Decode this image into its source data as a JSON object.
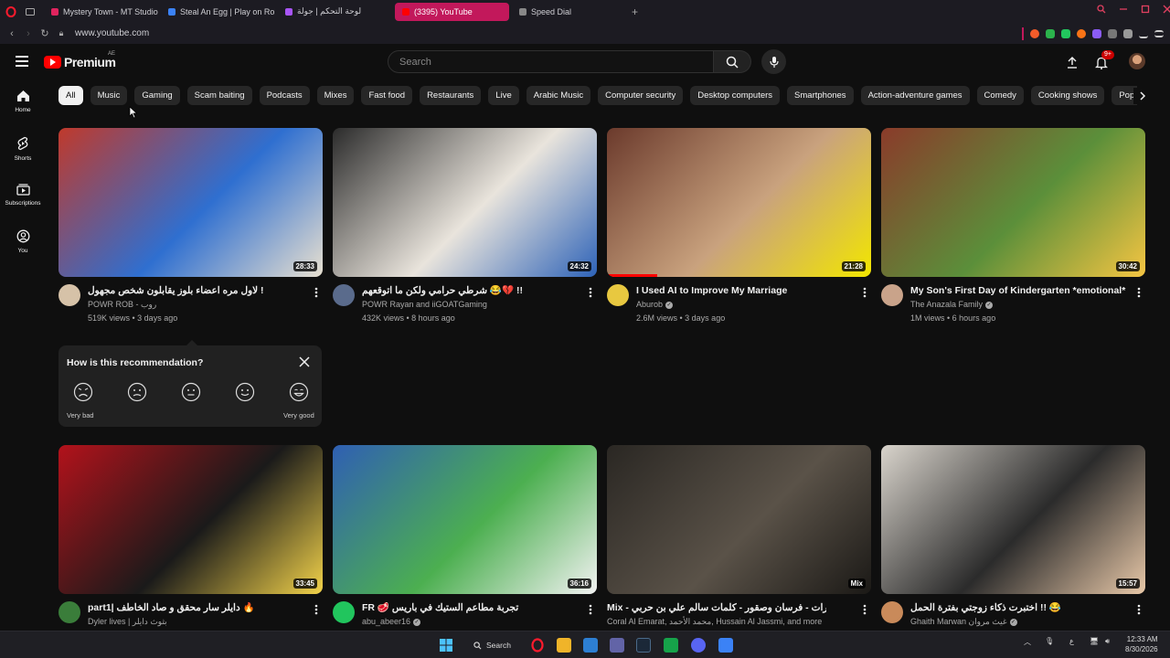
{
  "browser": {
    "tabs": [
      {
        "label": "Mystery Town - MT Studio",
        "color": "#e0245e",
        "active": false
      },
      {
        "label": "Steal An Egg | Play on Rob",
        "color": "#3b82f6",
        "active": false
      },
      {
        "label": "لوحة التحكم | جولة",
        "color": "#a855f7",
        "active": false
      },
      {
        "label": "(3395) YouTube",
        "color": "#ff0000",
        "active": true
      },
      {
        "label": "Speed Dial",
        "color": "#888888",
        "active": false
      }
    ],
    "url": "www.youtube.com",
    "accent": "#c2185b"
  },
  "header": {
    "logo_text": "Premium",
    "country_code": "AE",
    "search_placeholder": "Search",
    "notification_count": "9+"
  },
  "sidebar": {
    "items": [
      {
        "label": "Home",
        "icon": "home-icon"
      },
      {
        "label": "Shorts",
        "icon": "shorts-icon"
      },
      {
        "label": "Subscriptions",
        "icon": "subscriptions-icon"
      },
      {
        "label": "You",
        "icon": "you-icon"
      }
    ]
  },
  "chips": [
    "All",
    "Music",
    "Gaming",
    "Scam baiting",
    "Podcasts",
    "Mixes",
    "Fast food",
    "Restaurants",
    "Live",
    "Arabic Music",
    "Computer security",
    "Desktop computers",
    "Smartphones",
    "Action-adventure games",
    "Comedy",
    "Cooking shows",
    "Pop Music"
  ],
  "videos": [
    {
      "title": "لاول مره اعضاء بلوز يقابلون شخص مجهول !",
      "channel": "POWR ROB - روب",
      "stats": "519K views • 3 days ago",
      "duration": "28:33",
      "verified": false,
      "colors": [
        "#c0392b",
        "#2f6fd0",
        "#e8e0d0"
      ],
      "avatar_color": "#d6c2a8"
    },
    {
      "title": "شرطي حرامي ولكن ما اتوقعهم 😂💔 !!",
      "channel": "POWR Rayan and iiGOATGaming",
      "stats": "432K views • 8 hours ago",
      "duration": "24:32",
      "verified": false,
      "colors": [
        "#2b2b2b",
        "#e9e4dc",
        "#2e63b8"
      ],
      "avatar_color": "#5a6b8c"
    },
    {
      "title": "I Used AI to Improve My Marriage",
      "channel": "Aburob",
      "stats": "2.6M views • 3 days ago",
      "duration": "21:28",
      "verified": true,
      "colors": [
        "#6b3a2c",
        "#c9a27e",
        "#f2e600"
      ],
      "avatar_color": "#e8c840",
      "progress": 0.19
    },
    {
      "title": "My Son's First Day of Kindergarten *emotional*",
      "channel": "The Anazala Family",
      "stats": "1M views • 6 hours ago",
      "duration": "30:42",
      "verified": true,
      "colors": [
        "#8a3b2a",
        "#5b8f3a",
        "#f5c542"
      ],
      "avatar_color": "#c9a38a"
    },
    {
      "title": "part1| دايلر سار محقق و صاد الخاطف 🔥",
      "channel": "Dyler lives | بثوث دايلر",
      "stats": "",
      "duration": "33:45",
      "verified": false,
      "colors": [
        "#b3121b",
        "#1a1a1a",
        "#f2d24a"
      ],
      "avatar_color": "#3a7d3a"
    },
    {
      "title": "FR 🥩 تجربة مطاعم الستيك في باريس",
      "channel": "abu_abeer16",
      "stats": "",
      "duration": "36:16",
      "verified": true,
      "colors": [
        "#2f5fb3",
        "#4caf50",
        "#f2f2f2"
      ],
      "avatar_color": "#21c55d"
    },
    {
      "title": "Mix - كورال الامارات - فرسان وصقور - كلمات سالم علي بن حربي",
      "channel": "Coral Al Emarat, محمد الأحمد, Hussain Al Jassmi, and more",
      "stats": "",
      "duration": "Mix",
      "verified": false,
      "colors": [
        "#2a2723",
        "#5a5248",
        "#1b1916"
      ],
      "avatar_color": ""
    },
    {
      "title": "اختبرت ذكاء زوجتي بفترة الحمل !! 😂",
      "channel": "Ghaith Marwan غيث مروان",
      "stats": "",
      "duration": "15:57",
      "verified": true,
      "colors": [
        "#d9d4cc",
        "#2b2b2b",
        "#e8c8a8"
      ],
      "avatar_color": "#c98a5a"
    }
  ],
  "feedback": {
    "question": "How is this recommendation?",
    "low_label": "Very bad",
    "high_label": "Very good"
  },
  "taskbar": {
    "search_label": "Search",
    "time": "12:33 AM",
    "date": "8/30/2026",
    "lang": "ع"
  }
}
